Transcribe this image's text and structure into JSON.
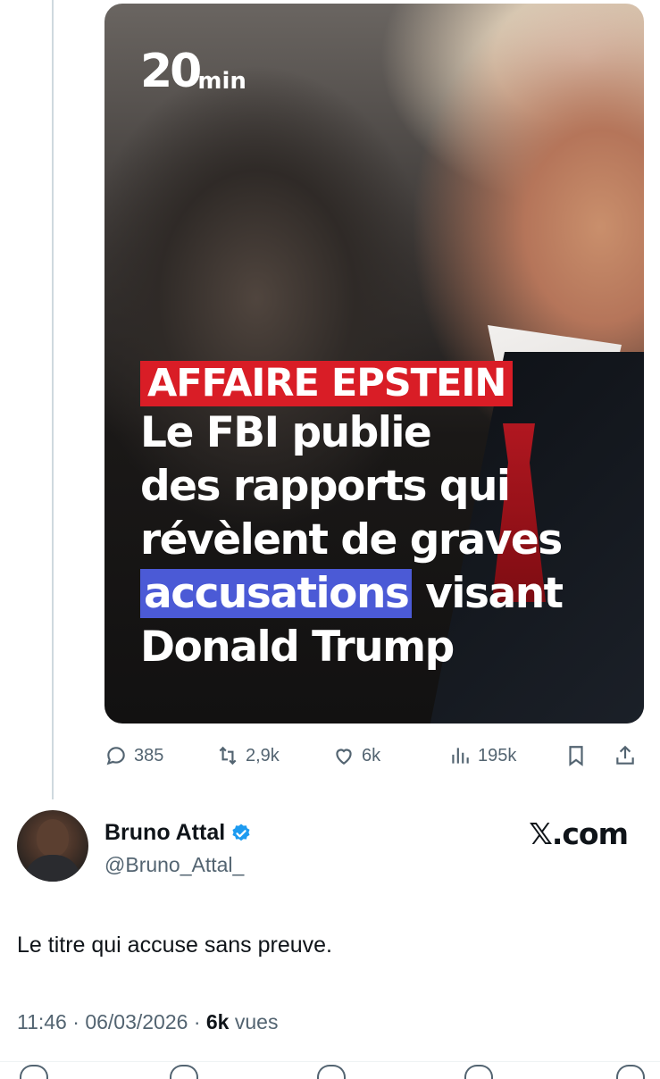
{
  "media": {
    "logo": {
      "number": "20",
      "unit": "min"
    },
    "tag": "AFFAIRE EPSTEIN",
    "lines": [
      "Le FBI publie",
      "des rapports qui",
      "révèlent de graves"
    ],
    "highlight_word": "accusations",
    "after_highlight": " visant",
    "last_line": "Donald Trump",
    "colors": {
      "tag": "#d91d26",
      "highlight": "#4b5ad6"
    }
  },
  "actions": {
    "replies": "385",
    "reposts": "2,9k",
    "likes": "6k",
    "views": "195k"
  },
  "author": {
    "name": "Bruno Attal",
    "handle": "@Bruno_Attal_",
    "verified_color": "#1d9bf0"
  },
  "brand": "𝕏.com",
  "tweet": {
    "text": "Le titre qui accuse sans preuve.",
    "time": "11:46",
    "date": "06/03/2026",
    "views": "6k",
    "views_label": "vues"
  },
  "icons": [
    "reply-icon",
    "repost-icon",
    "like-icon",
    "views-icon",
    "bookmark-icon",
    "share-icon",
    "verified-icon"
  ]
}
